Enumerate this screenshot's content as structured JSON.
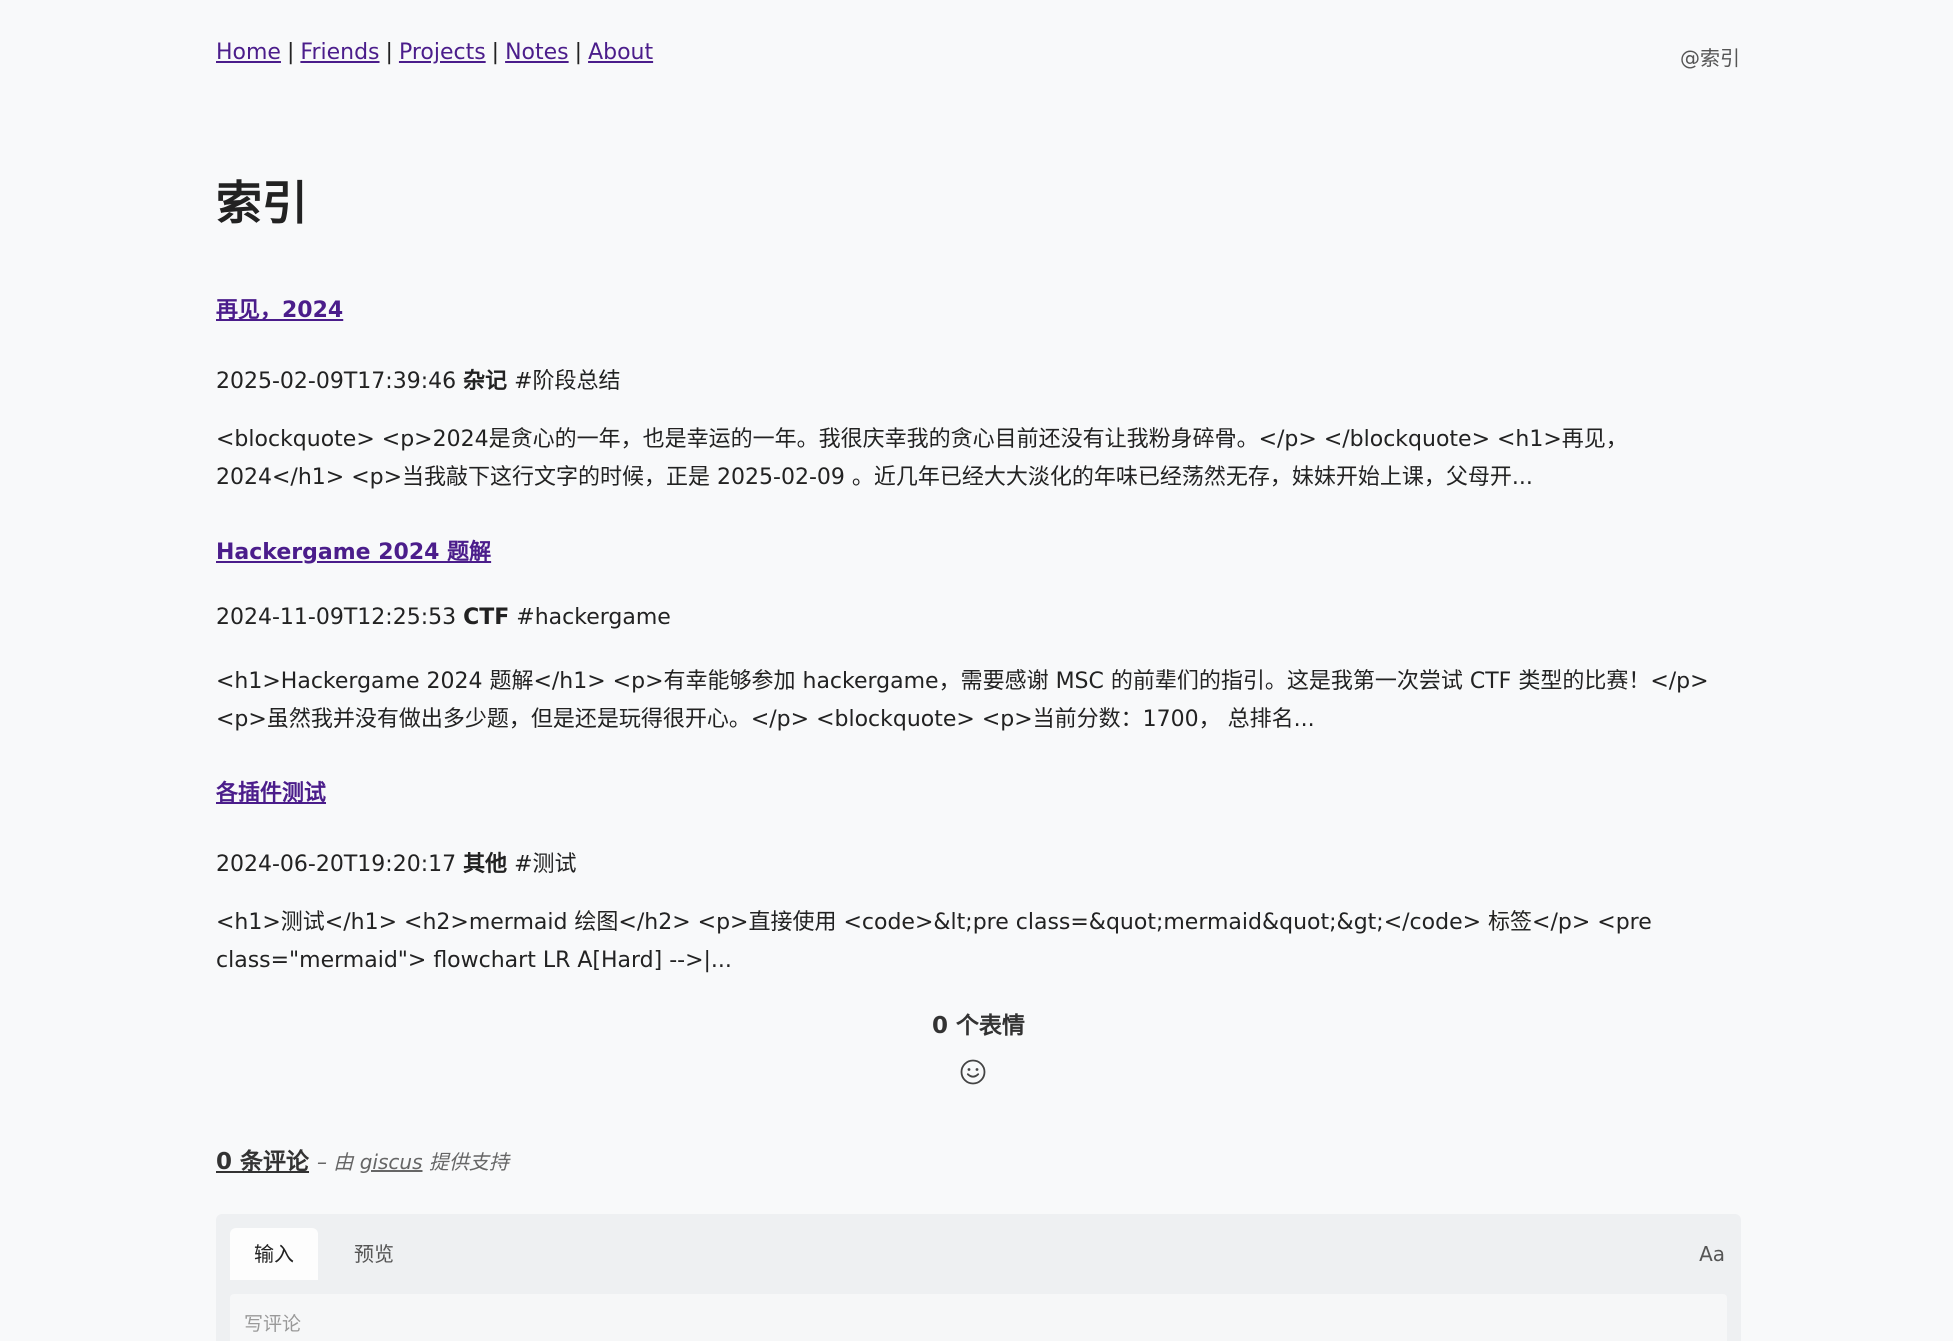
{
  "nav": {
    "items": [
      {
        "label": "Home"
      },
      {
        "label": "Friends"
      },
      {
        "label": "Projects"
      },
      {
        "label": "Notes"
      },
      {
        "label": "About"
      }
    ],
    "separator": "|",
    "crumb": "@索引"
  },
  "page": {
    "title": "索引"
  },
  "posts": [
    {
      "title": "再见，2024",
      "date": "2025-02-09T17:39:46",
      "category": "杂记",
      "tag": "#阶段总结",
      "excerpt": "<blockquote> <p>2024是贪心的一年，也是幸运的一年。我很庆幸我的贪心目前还没有让我粉身碎骨。</p> </blockquote> <h1>再见，2024</h1> <p>当我敲下这行文字的时候，正是 2025-02-09 。近几年已经大大淡化的年味已经荡然无存，妹妹开始上课，父母开..."
    },
    {
      "title": "Hackergame 2024 题解",
      "date": "2024-11-09T12:25:53",
      "category": "CTF",
      "tag": "#hackergame",
      "excerpt": "<h1>Hackergame 2024 题解</h1> <p>有幸能够参加 hackergame，需要感谢 MSC 的前辈们的指引。这是我第一次尝试 CTF 类型的比赛！</p> <p>虽然我并没有做出多少题，但是还是玩得很开心。</p> <blockquote> <p>当前分数：1700， 总排名..."
    },
    {
      "title": "各插件测试",
      "date": "2024-06-20T19:20:17",
      "category": "其他",
      "tag": "#测试",
      "excerpt": "<h1>测试</h1> <h2>mermaid 绘图</h2> <p>直接使用 <code>&lt;pre class=&quot;mermaid&quot;&gt;</code> 标签</p> <pre class=\"mermaid\"> flowchart LR A[Hard] -->|..."
    }
  ],
  "reactions": {
    "label": "0 个表情",
    "icon": "smiley-icon"
  },
  "comments": {
    "count_label": "0 条评论",
    "by_prefix": "– 由 ",
    "by_link": "giscus",
    "by_suffix": " 提供支持",
    "tabs": [
      {
        "label": "输入",
        "active": true
      },
      {
        "label": "预览",
        "active": false
      }
    ],
    "format_button": "Aa",
    "input_placeholder": "写评论",
    "input_value": ""
  },
  "colors": {
    "background": "#f8f9fa",
    "link": "#4b1d8b",
    "text": "#222222"
  }
}
